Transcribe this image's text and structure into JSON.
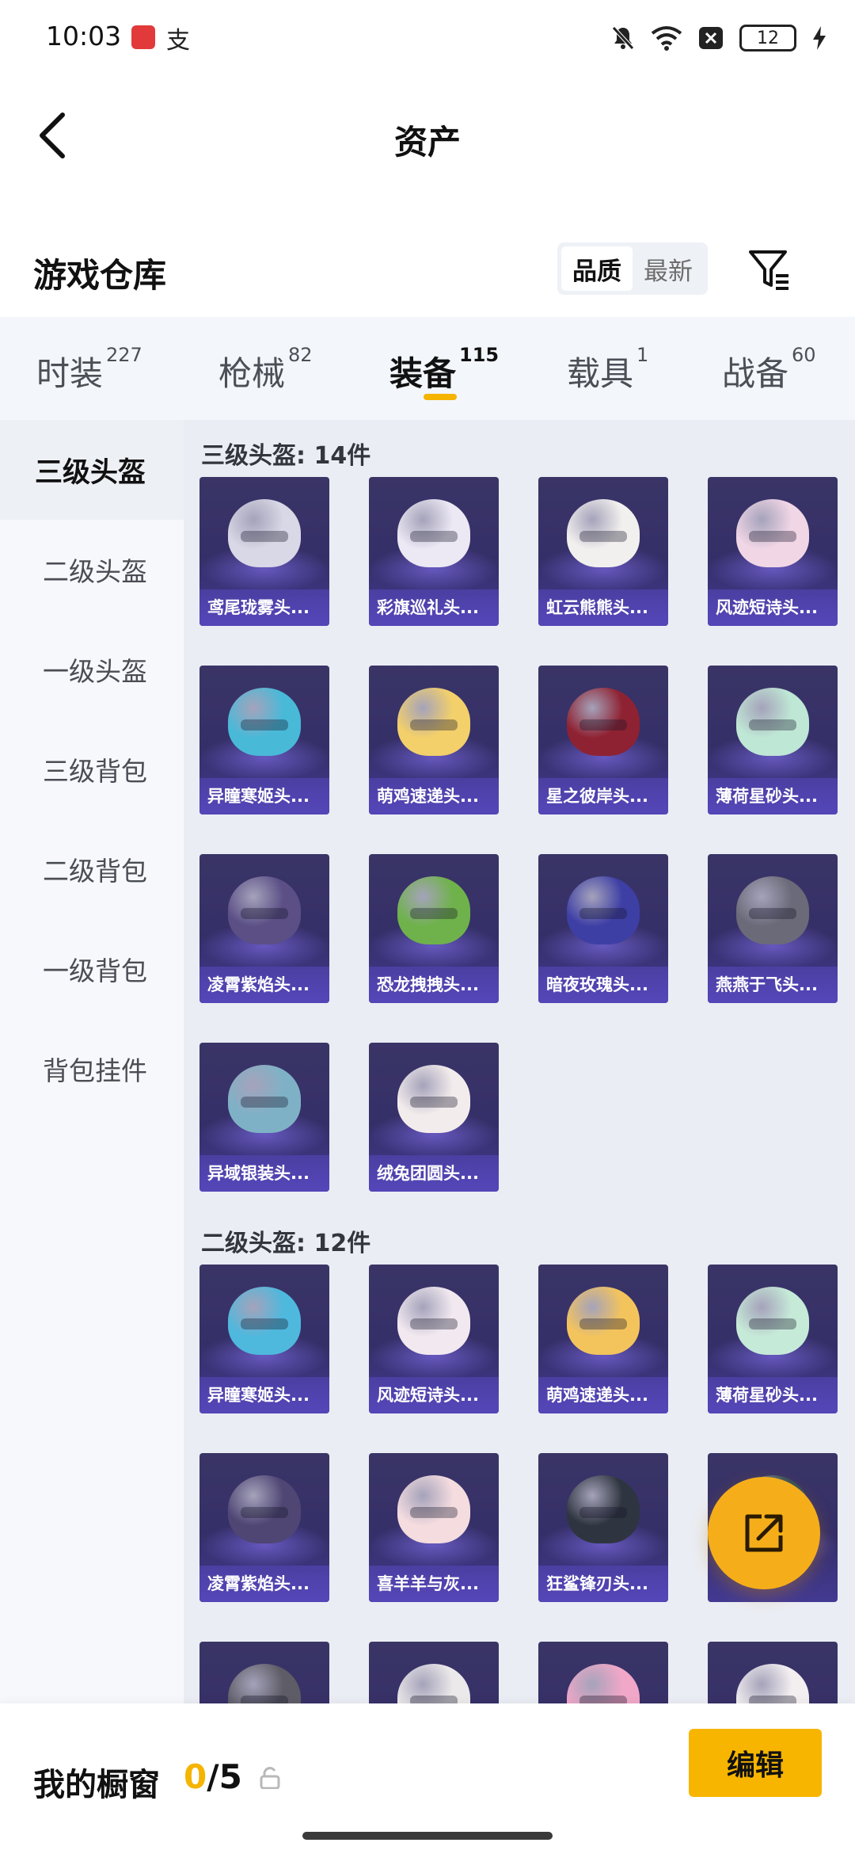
{
  "status_bar": {
    "time": "10:03",
    "app_icon_2": "支",
    "battery": "12"
  },
  "header": {
    "title": "资产"
  },
  "warehouse": {
    "title": "游戏仓库",
    "sort_options": [
      {
        "label": "品质",
        "active": true
      },
      {
        "label": "最新",
        "active": false
      }
    ]
  },
  "tabs": [
    {
      "label": "时装",
      "count": "227"
    },
    {
      "label": "枪械",
      "count": "82"
    },
    {
      "label": "装备",
      "count": "115",
      "active": true
    },
    {
      "label": "载具",
      "count": "1"
    },
    {
      "label": "战备",
      "count": "60"
    }
  ],
  "categories": [
    {
      "label": "三级头盔",
      "active": true
    },
    {
      "label": "二级头盔"
    },
    {
      "label": "一级头盔"
    },
    {
      "label": "三级背包"
    },
    {
      "label": "二级背包"
    },
    {
      "label": "一级背包"
    },
    {
      "label": "背包挂件"
    }
  ],
  "groups": [
    {
      "title": "三级头盔: 14件",
      "items": [
        {
          "name": "鸢尾珑雾头...",
          "color": "#d8d8e6"
        },
        {
          "name": "彩旗巡礼头...",
          "color": "#ece8f4"
        },
        {
          "name": "虹云熊熊头...",
          "color": "#f2f0ee"
        },
        {
          "name": "风迹短诗头...",
          "color": "#f1d6e6"
        },
        {
          "name": "异瞳寒姬头...",
          "color": "#49b9d8"
        },
        {
          "name": "萌鸡速递头...",
          "color": "#f3d06a"
        },
        {
          "name": "星之彼岸头...",
          "color": "#8e2232"
        },
        {
          "name": "薄荷星砂头...",
          "color": "#bfe7d5"
        },
        {
          "name": "凌霄紫焰头...",
          "color": "#5b4f86"
        },
        {
          "name": "恐龙拽拽头...",
          "color": "#6fb24b"
        },
        {
          "name": "暗夜玫瑰头...",
          "color": "#3e3fa5"
        },
        {
          "name": "燕燕于飞头...",
          "color": "#6b6a78"
        },
        {
          "name": "异域银装头...",
          "color": "#7fb1c6"
        },
        {
          "name": "绒兔团圆头...",
          "color": "#f3ecec"
        }
      ]
    },
    {
      "title": "二级头盔: 12件",
      "items": [
        {
          "name": "异瞳寒姬头...",
          "color": "#4fb8dd"
        },
        {
          "name": "风迹短诗头...",
          "color": "#f2e9f0"
        },
        {
          "name": "萌鸡速递头...",
          "color": "#f4c45c"
        },
        {
          "name": "薄荷星砂头...",
          "color": "#c6ead8"
        },
        {
          "name": "凌霄紫焰头...",
          "color": "#4f4674"
        },
        {
          "name": "喜羊羊与灰...",
          "color": "#f4dcdf"
        },
        {
          "name": "狂鲨锋刃头...",
          "color": "#2f3540"
        },
        {
          "name": "",
          "color": "#37505c"
        },
        {
          "name": "",
          "color": "#5e5c66"
        },
        {
          "name": "",
          "color": "#ece9ea"
        },
        {
          "name": "",
          "color": "#f0a7c8"
        },
        {
          "name": "",
          "color": "#f3eef0"
        }
      ]
    }
  ],
  "showcase": {
    "label": "我的橱窗",
    "current": "0",
    "total": "/5"
  },
  "edit_button": "编辑"
}
